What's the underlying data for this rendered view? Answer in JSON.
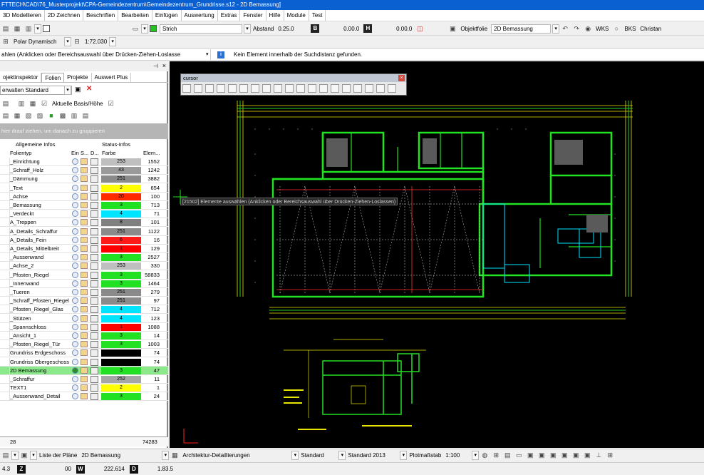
{
  "window": {
    "title": "FTTECH\\CAD\\76_Musterprojekt\\CPA-Gemeindezentrum\\Gemeindezentrum_Grundrisse.s12 - 2D Bemassung]"
  },
  "menu": [
    "3D Modellieren",
    "2D Zeichnen",
    "Beschriften",
    "Bearbeiten",
    "Einfügen",
    "Auswertung",
    "Extras",
    "Fenster",
    "Hilfe",
    "Module",
    "Test"
  ],
  "toolbar1": {
    "linetype": "Strich",
    "abstand_label": "Abstand",
    "abstand_value": "0.25.0",
    "b_letter": "B",
    "b_value": "0.00.0",
    "h_letter": "H",
    "h_value": "0.00.0",
    "objektfolie_label": "Objektfolie",
    "objektfolie_value": "2D Bemassung",
    "wks_label": "WKS",
    "bks_label": "BKS",
    "user": "Christan",
    "accent": "#22c322"
  },
  "toolbar2": {
    "snap_mode": "Polar Dynamisch",
    "scale": "1:72.030"
  },
  "message": {
    "left": "ahlen (Anklicken oder Bereichsauswahl über Drücken-Ziehen-Loslasse",
    "right": "Kein Element innerhalb der Suchdistanz gefunden."
  },
  "panel": {
    "tabs": [
      "ojektinspektor",
      "Folien",
      "Projekte",
      "Auswert Plus"
    ],
    "active_tab": "Folien",
    "dropdown": "erwalten Standard",
    "checkbox_label": "Aktuelle Basis/Höhe",
    "group_hint": "hier drauf ziehen, um danach zu gruppieren",
    "col_group_general": "Allgemeine Infos",
    "col_group_status": "Status-Infos",
    "col_folientyp": "Folientyp",
    "col_ein": "Ein",
    "col_s": "S...",
    "col_d": "D...",
    "col_farbe": "Farbe",
    "col_elem": "Elem...",
    "layers": [
      {
        "name": "_Einrichtung",
        "color": "253",
        "bg": "#bfbfbf",
        "count": "1552"
      },
      {
        "name": "_Schraff_Holz",
        "color": "43",
        "bg": "#9a9a9a",
        "count": "1242"
      },
      {
        "name": "_Dämmung",
        "color": "251",
        "bg": "#8a8a8a",
        "count": "3882"
      },
      {
        "name": "_Text",
        "color": "2",
        "bg": "#ffff00",
        "count": "654"
      },
      {
        "name": "_Achse",
        "color": "20",
        "bg": "#ff2a00",
        "count": "100"
      },
      {
        "name": "_Bemassung",
        "color": "3",
        "bg": "#22e022",
        "count": "713"
      },
      {
        "name": "_Verdeckt",
        "color": "4",
        "bg": "#00e5ff",
        "count": "71"
      },
      {
        "name": "A_Treppen",
        "color": "8",
        "bg": "#808080",
        "count": "101"
      },
      {
        "name": "A_Details_Schraffur",
        "color": "251",
        "bg": "#8a8a8a",
        "count": "1122"
      },
      {
        "name": "A_Details_Fein",
        "color": "6",
        "bg": "#ff1a1a",
        "count": "16"
      },
      {
        "name": "A_Details_Mittelbreit",
        "color": "1",
        "bg": "#ff0000",
        "count": "129"
      },
      {
        "name": "_Aussenwand",
        "color": "3",
        "bg": "#22e022",
        "count": "2527"
      },
      {
        "name": "_Achse_2",
        "color": "253",
        "bg": "#bfbfbf",
        "count": "330"
      },
      {
        "name": "_Pfosten_Riegel",
        "color": "3",
        "bg": "#22e022",
        "count": "58833"
      },
      {
        "name": "_Innenwand",
        "color": "3",
        "bg": "#22e022",
        "count": "1464"
      },
      {
        "name": "_Tueren",
        "color": "251",
        "bg": "#8a8a8a",
        "count": "279"
      },
      {
        "name": "_Schraff_Pfosten_Riegel",
        "color": "251",
        "bg": "#8a8a8a",
        "count": "97"
      },
      {
        "name": "_Pfosten_Riegel_Glas",
        "color": "4",
        "bg": "#00e5ff",
        "count": "712"
      },
      {
        "name": "_Stützen",
        "color": "4",
        "bg": "#00e5ff",
        "count": "123"
      },
      {
        "name": "_Spannschloss",
        "color": "1",
        "bg": "#ff0000",
        "count": "1088"
      },
      {
        "name": "_Ansicht_1",
        "color": "3",
        "bg": "#22e022",
        "count": "14"
      },
      {
        "name": "_Pfosten_Riegel_Tür",
        "color": "3",
        "bg": "#22e022",
        "count": "1003"
      },
      {
        "name": "Grundriss Erdgeschoss",
        "color": "",
        "bg": "#000000",
        "count": "74"
      },
      {
        "name": "Grundriss Obergeschoss",
        "color": "",
        "bg": "#000000",
        "count": "74"
      },
      {
        "name": "2D Bemassung",
        "color": "3",
        "bg": "#22e022",
        "count": "47",
        "selected": true
      },
      {
        "name": "_Schraffur",
        "color": "252",
        "bg": "#a6a6a6",
        "count": "11"
      },
      {
        "name": "TEXT1",
        "color": "2",
        "bg": "#ffff00",
        "count": "1"
      },
      {
        "name": "_Aussenwand_Detail",
        "color": "3",
        "bg": "#22e022",
        "count": "24"
      }
    ],
    "footer_count": "28",
    "footer_total": "74283"
  },
  "canvas": {
    "cursor_title": "cursor",
    "tooltip": "[21502] Elemente auswählen (Anklicken oder Bereichsauswahl über Drücken-Ziehen-Loslassen)"
  },
  "status1": {
    "plans_label": "Liste der Pläne",
    "plans_value": "2D Bemassung",
    "detail_value": "Architektur-Detaillierungen",
    "standard1": "Standard",
    "standard2": "Standard 2013",
    "plot_label": "Plotmaßstab",
    "plot_value": "1:100"
  },
  "status2": {
    "v1": "4.3",
    "z": "Z",
    "v2": "00",
    "w": "W",
    "v3": "222.614",
    "d": "D",
    "v4": "1.83.5"
  }
}
